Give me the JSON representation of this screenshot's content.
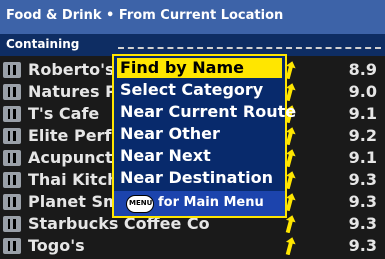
{
  "header": {
    "title": "Food & Drink • From Current Location",
    "containing_label": "Containing"
  },
  "list": [
    {
      "name": "Roberto's Italian Bistro",
      "distance": "8.9"
    },
    {
      "name": "Natures Pantry",
      "distance": "9.0"
    },
    {
      "name": "T's Cafe",
      "distance": "9.1"
    },
    {
      "name": "Elite Performance",
      "distance": "9.2"
    },
    {
      "name": "Acupuncture",
      "distance": "9.1"
    },
    {
      "name": "Thai Kitchen",
      "distance": "9.3"
    },
    {
      "name": "Planet Smoothie",
      "distance": "9.3"
    },
    {
      "name": "Starbucks Coffee Co",
      "distance": "9.3"
    },
    {
      "name": "Togo's",
      "distance": "9.3"
    }
  ],
  "menu": {
    "items": [
      {
        "label": "Find by Name",
        "selected": true
      },
      {
        "label": "Select Category",
        "selected": false
      },
      {
        "label": "Near Current Route",
        "selected": false
      },
      {
        "label": "Near Other",
        "selected": false
      },
      {
        "label": "Near Next",
        "selected": false
      },
      {
        "label": "Near Destination",
        "selected": false
      }
    ],
    "footer_button": "MENU",
    "footer_text": "for Main Menu"
  },
  "colors": {
    "header": "#3d63a8",
    "containing_bar": "#0e2d63",
    "background": "#1a1a1a",
    "menu_bg": "#082a6c",
    "menu_border": "#ffe600",
    "arrow": "#ffe600"
  },
  "icons": {
    "list_item": "fork-knife-icon",
    "direction": "direction-arrow-icon",
    "distance_unit": "miles-icon"
  }
}
